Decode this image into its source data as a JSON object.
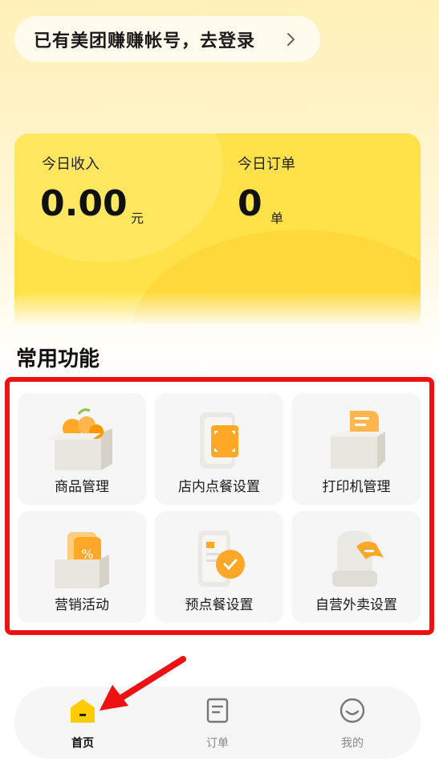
{
  "header": {
    "login_prompt": "已有美团赚赚帐号，去登录"
  },
  "stats": {
    "income_label": "今日收入",
    "income_value": "0.00",
    "income_unit": "元",
    "orders_label": "今日订单",
    "orders_value": "0",
    "orders_unit": "单"
  },
  "functions": {
    "title": "常用功能",
    "items": [
      {
        "label": "商品管理",
        "icon": "product-box-icon"
      },
      {
        "label": "店内点餐设置",
        "icon": "dine-in-order-icon"
      },
      {
        "label": "打印机管理",
        "icon": "printer-icon"
      },
      {
        "label": "营销活动",
        "icon": "marketing-coupon-icon"
      },
      {
        "label": "预点餐设置",
        "icon": "preorder-clock-icon"
      },
      {
        "label": "自营外卖设置",
        "icon": "delivery-bag-icon"
      }
    ]
  },
  "tabbar": {
    "items": [
      {
        "label": "首页",
        "icon": "home-icon",
        "active": true
      },
      {
        "label": "订单",
        "icon": "orders-icon",
        "active": false
      },
      {
        "label": "我的",
        "icon": "profile-icon",
        "active": false
      }
    ]
  },
  "colors": {
    "accent_yellow": "#ffe24a",
    "highlight_red": "#ee1111",
    "icon_orange": "#ffa726"
  }
}
